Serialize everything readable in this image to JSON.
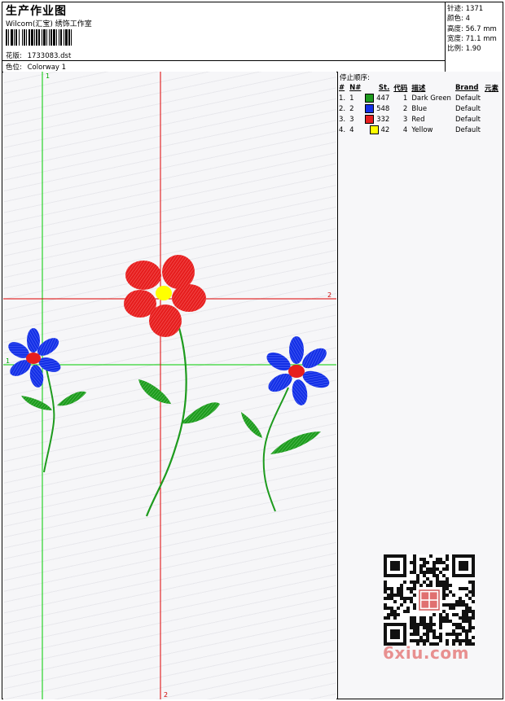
{
  "header": {
    "title": "生产作业图",
    "studio": "Wilcom(汇宝) 绣饰工作室",
    "design_label": "花版:",
    "design_value": "1733083.dst",
    "colorway_label": "色位:",
    "colorway_value": "Colorway 1"
  },
  "stats": [
    {
      "label": "针迹:",
      "value": "1371"
    },
    {
      "label": "颜色:",
      "value": "4"
    },
    {
      "label": "高度:",
      "value": "56.7 mm"
    },
    {
      "label": "宽度:",
      "value": "71.1 mm"
    },
    {
      "label": "比例:",
      "value": "1.90"
    }
  ],
  "stop_sequence": {
    "heading": "停止顺序:",
    "columns": [
      "#",
      "N#",
      "St.",
      "代码",
      "描述",
      "Brand",
      "元素"
    ],
    "rows": [
      {
        "idx": "1.",
        "n": "1",
        "color": "#1e9b1e",
        "stitches": "447",
        "code": "1",
        "desc": "Dark Green",
        "brand": "Default"
      },
      {
        "idx": "2.",
        "n": "2",
        "color": "#1430e6",
        "stitches": "548",
        "code": "2",
        "desc": "Blue",
        "brand": "Default"
      },
      {
        "idx": "3.",
        "n": "3",
        "color": "#e61e1e",
        "stitches": "332",
        "code": "3",
        "desc": "Red",
        "brand": "Default"
      },
      {
        "idx": "4.",
        "n": "4",
        "color": "#ffff00",
        "stitches": "42",
        "code": "4",
        "desc": "Yellow",
        "brand": "Default"
      }
    ]
  },
  "guides": {
    "label_1": "1",
    "label_2": "2",
    "vertical_color": "#00cc00",
    "horizontal_color": "#dd0000"
  },
  "watermark": "6xiu.com"
}
